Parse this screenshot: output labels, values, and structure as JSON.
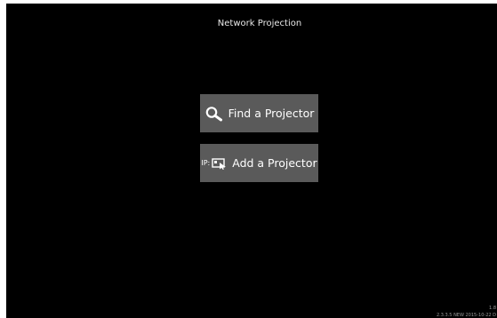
{
  "screen": {
    "title": "Network Projection"
  },
  "buttons": {
    "find_label": "Find a Projector",
    "find_icon": "search-icon",
    "add_label": "Add a Projector",
    "add_prefix": "IP:",
    "add_icon": "projector-add-icon"
  },
  "footer": {
    "version": "1.8",
    "build": "2.3.3.5 NEW 2015-10-22 D"
  },
  "colors": {
    "background": "#000000",
    "button": "#5a5a5a",
    "text": "#ffffff"
  }
}
